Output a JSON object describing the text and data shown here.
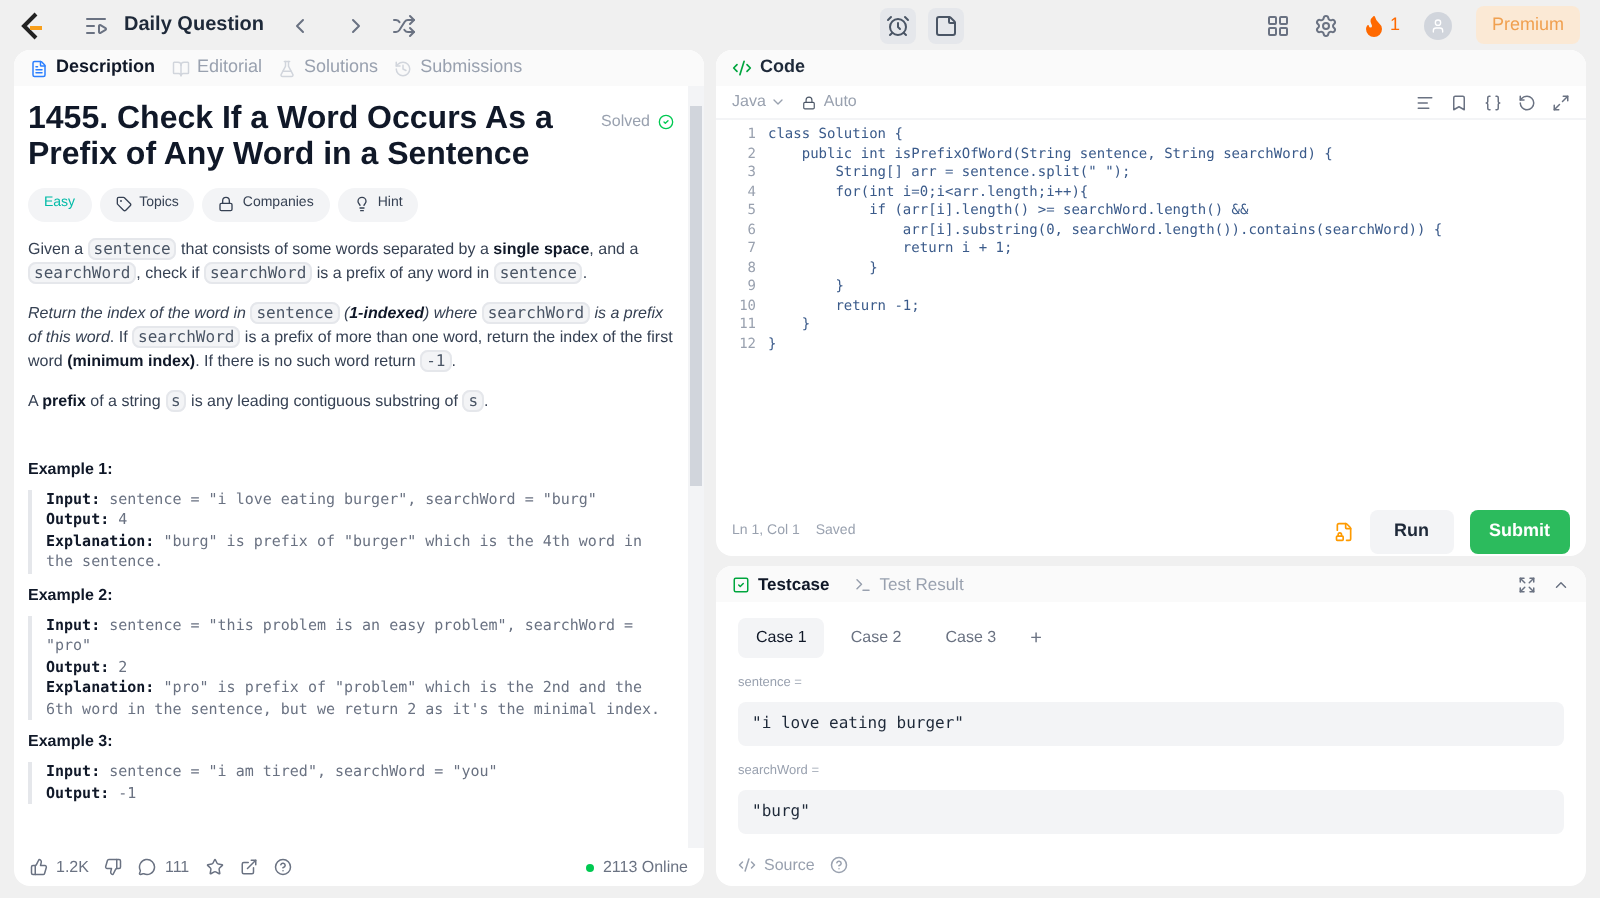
{
  "topbar": {
    "title": "Daily Question",
    "streak": "1",
    "premium": "Premium"
  },
  "left_tabs": [
    {
      "label": "Description",
      "selected": true
    },
    {
      "label": "Editorial",
      "selected": false
    },
    {
      "label": "Solutions",
      "selected": false
    },
    {
      "label": "Submissions",
      "selected": false
    }
  ],
  "problem": {
    "title": "1455. Check If a Word Occurs As a Prefix of Any Word in a Sentence",
    "status": "Solved",
    "difficulty": "Easy",
    "tags": [
      "Topics",
      "Companies",
      "Hint"
    ],
    "paragraphs": [
      [
        {
          "kind": "text",
          "text": "Given a "
        },
        {
          "kind": "code",
          "text": "sentence"
        },
        {
          "kind": "text",
          "text": " that consists of some words separated by a "
        },
        {
          "kind": "bold",
          "text": "single space"
        },
        {
          "kind": "text",
          "text": ", and a "
        },
        {
          "kind": "code",
          "text": "searchWord"
        },
        {
          "kind": "text",
          "text": ", check if "
        },
        {
          "kind": "code",
          "text": "searchWord"
        },
        {
          "kind": "text",
          "text": " is a prefix of any word in "
        },
        {
          "kind": "code",
          "text": "sentence"
        },
        {
          "kind": "text",
          "text": "."
        }
      ],
      [
        {
          "kind": "italic",
          "text": "Return the index of the word in "
        },
        {
          "kind": "code",
          "text": "sentence"
        },
        {
          "kind": "italic",
          "text": " ("
        },
        {
          "kind": "bolditalic",
          "text": "1-indexed"
        },
        {
          "kind": "italic",
          "text": ") where "
        },
        {
          "kind": "code",
          "text": "searchWord"
        },
        {
          "kind": "italic",
          "text": " is a prefix of this word"
        },
        {
          "kind": "text",
          "text": ". If "
        },
        {
          "kind": "code",
          "text": "searchWord"
        },
        {
          "kind": "text",
          "text": " is a prefix of more than one word, return the index of the first word "
        },
        {
          "kind": "bold",
          "text": "(minimum index)"
        },
        {
          "kind": "text",
          "text": ". If there is no such word return "
        },
        {
          "kind": "code",
          "text": "-1"
        },
        {
          "kind": "text",
          "text": "."
        }
      ],
      [
        {
          "kind": "text",
          "text": "A "
        },
        {
          "kind": "bold",
          "text": "prefix"
        },
        {
          "kind": "text",
          "text": " of a string "
        },
        {
          "kind": "code",
          "text": "s"
        },
        {
          "kind": "text",
          "text": " is any leading contiguous substring of "
        },
        {
          "kind": "code",
          "text": "s"
        },
        {
          "kind": "text",
          "text": "."
        }
      ]
    ],
    "examples": [
      {
        "heading": "Example 1:",
        "lines": [
          {
            "label": "Input:",
            "text": "sentence = \"i love eating burger\", searchWord = \"burg\""
          },
          {
            "label": "Output:",
            "text": "4"
          },
          {
            "label": "Explanation:",
            "text": "\"burg\" is prefix of \"burger\" which is the 4th word in the sentence."
          }
        ]
      },
      {
        "heading": "Example 2:",
        "lines": [
          {
            "label": "Input:",
            "text": "sentence = \"this problem is an easy problem\", searchWord = \"pro\""
          },
          {
            "label": "Output:",
            "text": "2"
          },
          {
            "label": "Explanation:",
            "text": "\"pro\" is prefix of \"problem\" which is the 2nd and the 6th word in the sentence, but we return 2 as it's the minimal index."
          }
        ]
      },
      {
        "heading": "Example 3:",
        "lines": [
          {
            "label": "Input:",
            "text": "sentence = \"i am tired\", searchWord = \"you\""
          },
          {
            "label": "Output:",
            "text": "-1"
          }
        ]
      }
    ]
  },
  "footer": {
    "likes": "1.2K",
    "comments": "111",
    "online": "2113 Online"
  },
  "code_panel": {
    "title": "Code",
    "language": "Java",
    "mode": "Auto",
    "lines": [
      "class Solution {",
      "    public int isPrefixOfWord(String sentence, String searchWord) {",
      "        String[] arr = sentence.split(\" \");",
      "        for(int i=0;i<arr.length;i++){",
      "            if (arr[i].length() >= searchWord.length() &&",
      "                arr[i].substring(0, searchWord.length()).contains(searchWord)) {",
      "                return i + 1;",
      "            }",
      "        }",
      "        return -1;",
      "    }",
      "}"
    ],
    "line_numbers": [
      "1",
      "2",
      "3",
      "4",
      "5",
      "6",
      "7",
      "8",
      "9",
      "10",
      "11",
      "12"
    ],
    "position": "Ln 1, Col 1",
    "saved": "Saved",
    "run": "Run",
    "submit": "Submit"
  },
  "test_tabs": [
    {
      "label": "Testcase",
      "selected": true
    },
    {
      "label": "Test Result",
      "selected": false
    }
  ],
  "cases": [
    {
      "label": "Case 1",
      "selected": true
    },
    {
      "label": "Case 2",
      "selected": false
    },
    {
      "label": "Case 3",
      "selected": false
    }
  ],
  "add_case": "+",
  "params": [
    {
      "name": "sentence =",
      "value": "\"i love eating burger\""
    },
    {
      "name": "searchWord =",
      "value": "\"burg\""
    }
  ],
  "source": "Source"
}
